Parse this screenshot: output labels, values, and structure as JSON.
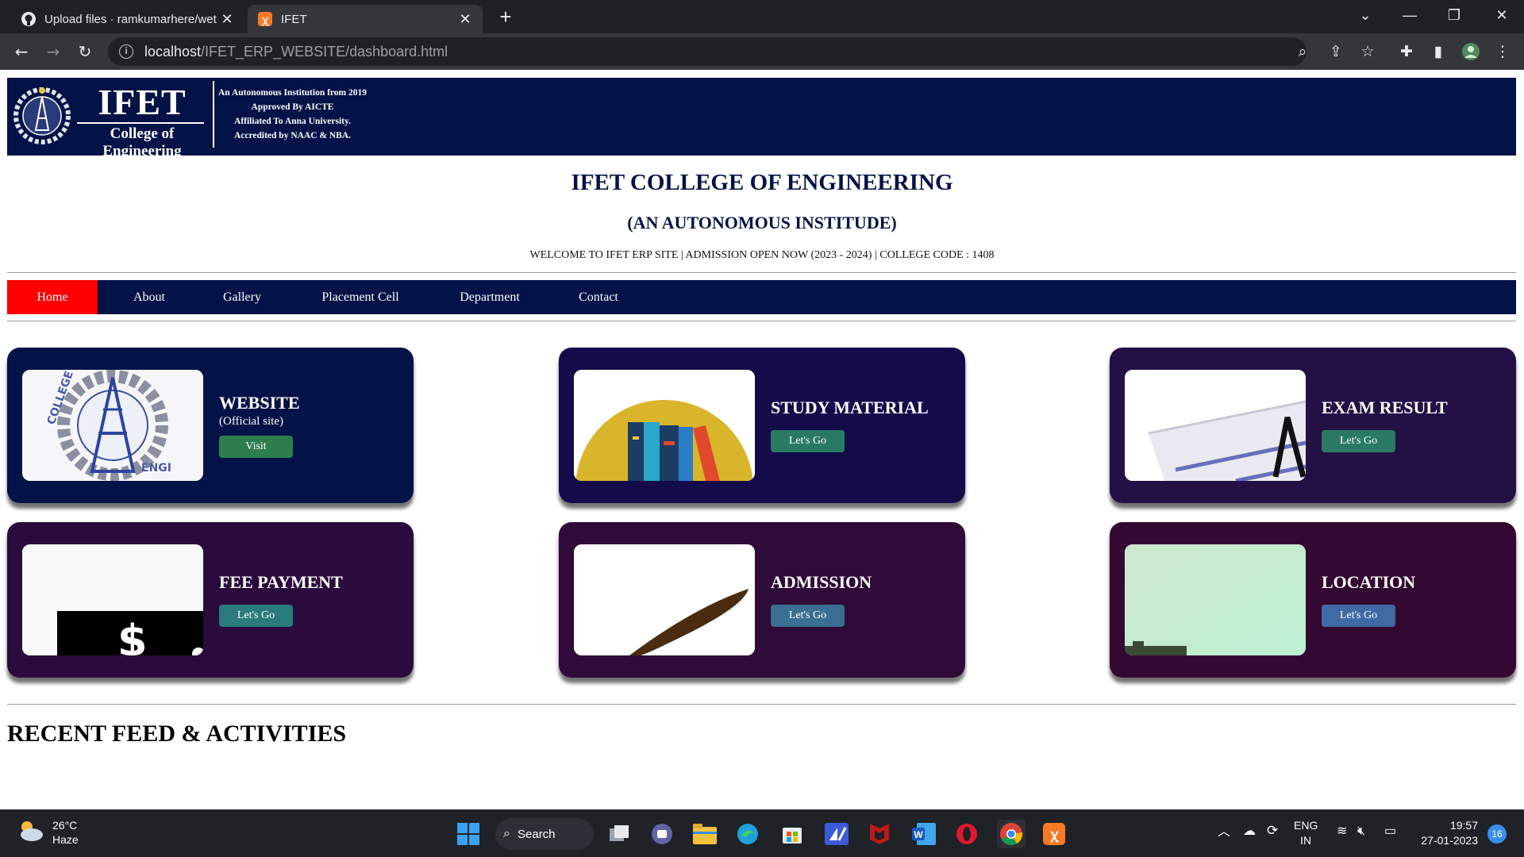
{
  "browser": {
    "tabs": [
      {
        "title": "Upload files · ramkumarhere/wet",
        "active": false
      },
      {
        "title": "IFET",
        "active": true
      }
    ],
    "url_host": "localhost",
    "url_path": "/IFET_ERP_WEBSITE/dashboard.html"
  },
  "banner": {
    "logo_name": "IFET",
    "logo_subtitle": "College of Engineering",
    "info_lines": [
      "An Autonomous Institution from 2019",
      "Approved By AICTE",
      "Affiliated To Anna University.",
      "Accredited by NAAC & NBA."
    ]
  },
  "header": {
    "title": "IFET COLLEGE OF ENGINEERING",
    "subtitle": "(AN AUTONOMOUS INSTITUDE)",
    "welcome": "WELCOME TO IFET ERP SITE | ADMISSION OPEN NOW (2023 - 2024) | COLLEGE CODE : 1408"
  },
  "nav": {
    "items": [
      "Home",
      "About",
      "Gallery",
      "Placement Cell",
      "Department",
      "Contact"
    ],
    "active": "Home"
  },
  "cards": [
    {
      "title": "WEBSITE",
      "subtitle": "(Official site)",
      "button": "Visit",
      "bg": "#031247",
      "button_color": "#2e7d4f"
    },
    {
      "title": "STUDY MATERIAL",
      "button": "Let's Go",
      "bg": "#140b4a",
      "button_color": "#2a7a63"
    },
    {
      "title": "EXAM RESULT",
      "button": "Let's Go",
      "bg": "#231045",
      "button_color": "#2a7a63"
    },
    {
      "title": "FEE PAYMENT",
      "button": "Let's Go",
      "bg": "#2b0a3e",
      "button_color": "#2a7a7e"
    },
    {
      "title": "ADMISSION",
      "button": "Let's Go",
      "bg": "#300a38",
      "button_color": "#3a6f92"
    },
    {
      "title": "LOCATION",
      "button": "Let's Go",
      "bg": "#330932",
      "button_color": "#3f6aa5"
    }
  ],
  "feed": {
    "title": "RECENT FEED & ACTIVITIES"
  },
  "taskbar": {
    "weather_temp": "26°C",
    "weather_desc": "Haze",
    "search_label": "Search",
    "lang_line1": "ENG",
    "lang_line2": "IN",
    "time": "19:57",
    "date": "27-01-2023",
    "notification_count": "16"
  },
  "colors": {
    "navy": "#031247",
    "active_nav": "#ff0000"
  }
}
